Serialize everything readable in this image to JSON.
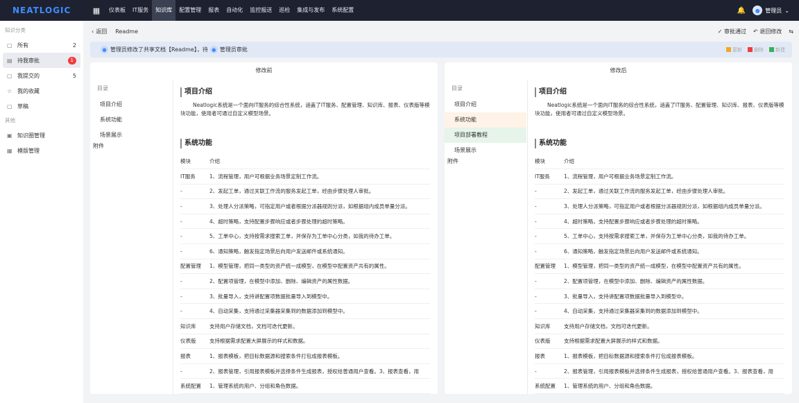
{
  "topbar": {
    "logo": "NEATLOGIC",
    "nav": [
      "仪表板",
      "IT服务",
      "知识库",
      "配置管理",
      "报表",
      "自动化",
      "监控报送",
      "巡检",
      "集成与发布",
      "系统配置"
    ],
    "active_nav": "知识库",
    "user": "管理员"
  },
  "sidebar": {
    "section1": "知识分类",
    "items": [
      {
        "label": "所有",
        "count": "2"
      },
      {
        "label": "待我审批",
        "badge": "1"
      },
      {
        "label": "我提交的",
        "count": "5"
      },
      {
        "label": "我的收藏",
        "count": ""
      },
      {
        "label": "草稿",
        "count": ""
      }
    ],
    "section2": "其他",
    "others": [
      {
        "label": "知识圈管理"
      },
      {
        "label": "模版管理"
      }
    ]
  },
  "header": {
    "back": "返回",
    "doc": "Readme",
    "approve": "审批通过",
    "reject": "退回修改"
  },
  "notice": {
    "p1": "管理员修改了共享文档【Readme】，待",
    "p2": "管理员审批",
    "legend": {
      "update": "更新",
      "delete": "删除",
      "add": "新建"
    },
    "colors": {
      "update": "#f5a623",
      "delete": "#f23c3c",
      "add": "#34b15a"
    }
  },
  "left": {
    "title": "修改前",
    "toc_title": "目录",
    "toc": [
      "项目介绍",
      "系统功能",
      "场景展示"
    ],
    "toc_attach": "附件"
  },
  "right": {
    "title": "修改后",
    "toc_title": "目录",
    "toc": [
      "项目介绍",
      "系统功能",
      "项目部署教程",
      "场景展示"
    ],
    "toc_attach": "附件"
  },
  "doc": {
    "h1": "项目介绍",
    "intro": "Neatlogic系统是一个面向IT服务的综合性系统，涵盖了IT服务、配置管理、知识库、报表、仪表版等模块功能，使用者可通过自定义模型场景。",
    "h2": "系统功能",
    "table_header": [
      "模块",
      "介绍"
    ],
    "rows": [
      [
        "IT服务",
        "1、流程管理，用户可根据业务场景定制工作流。"
      ],
      [
        "-",
        "2、发起工单，通过关联工作流的服务发起工单，经由步骤处理人审批。"
      ],
      [
        "-",
        "3、处理人分派策略，可指定用户或者根据分派器规则分派，如根据组内成员单量分派。"
      ],
      [
        "-",
        "4、超时策略，支持配置步骤响应或者步骤处理的超时策略。"
      ],
      [
        "-",
        "5、工单中心，支持按需求搜索工单，并保存为工单中心分类，如我的待办工单。"
      ],
      [
        "-",
        "6、通知策略，触发指定场景后向用户发送邮件或系统通知。"
      ],
      [
        "配置管理",
        "1、模型管理，把同一类型的资产统一成模型，在模型中配置资产共有的属性。"
      ],
      [
        "-",
        "2、配置项管理，在模型中添加、删除、编辑资产的属性数据。"
      ],
      [
        "-",
        "3、批量导入，支持讲配置项数据批量导入到模型中。"
      ],
      [
        "-",
        "4、自动采集，支持通过采集器采集到的数据添加到模型中。"
      ],
      [
        "知识库",
        "支持用户存储文档，文档可迭代更新。"
      ],
      [
        "仪表版",
        "支持根据需求配置大屏展示的样式和数据。"
      ],
      [
        "报表",
        "1、报表模板，把目标数据源和搜索条件打包成报表模板。"
      ],
      [
        "-",
        "2、报表管理，引用报表模板并选择条件生成报表，授权给普通用户查看。3、报表查看，用"
      ],
      [
        "系统配置",
        "1、管理系统的用户、分组和角色数据。"
      ]
    ]
  }
}
